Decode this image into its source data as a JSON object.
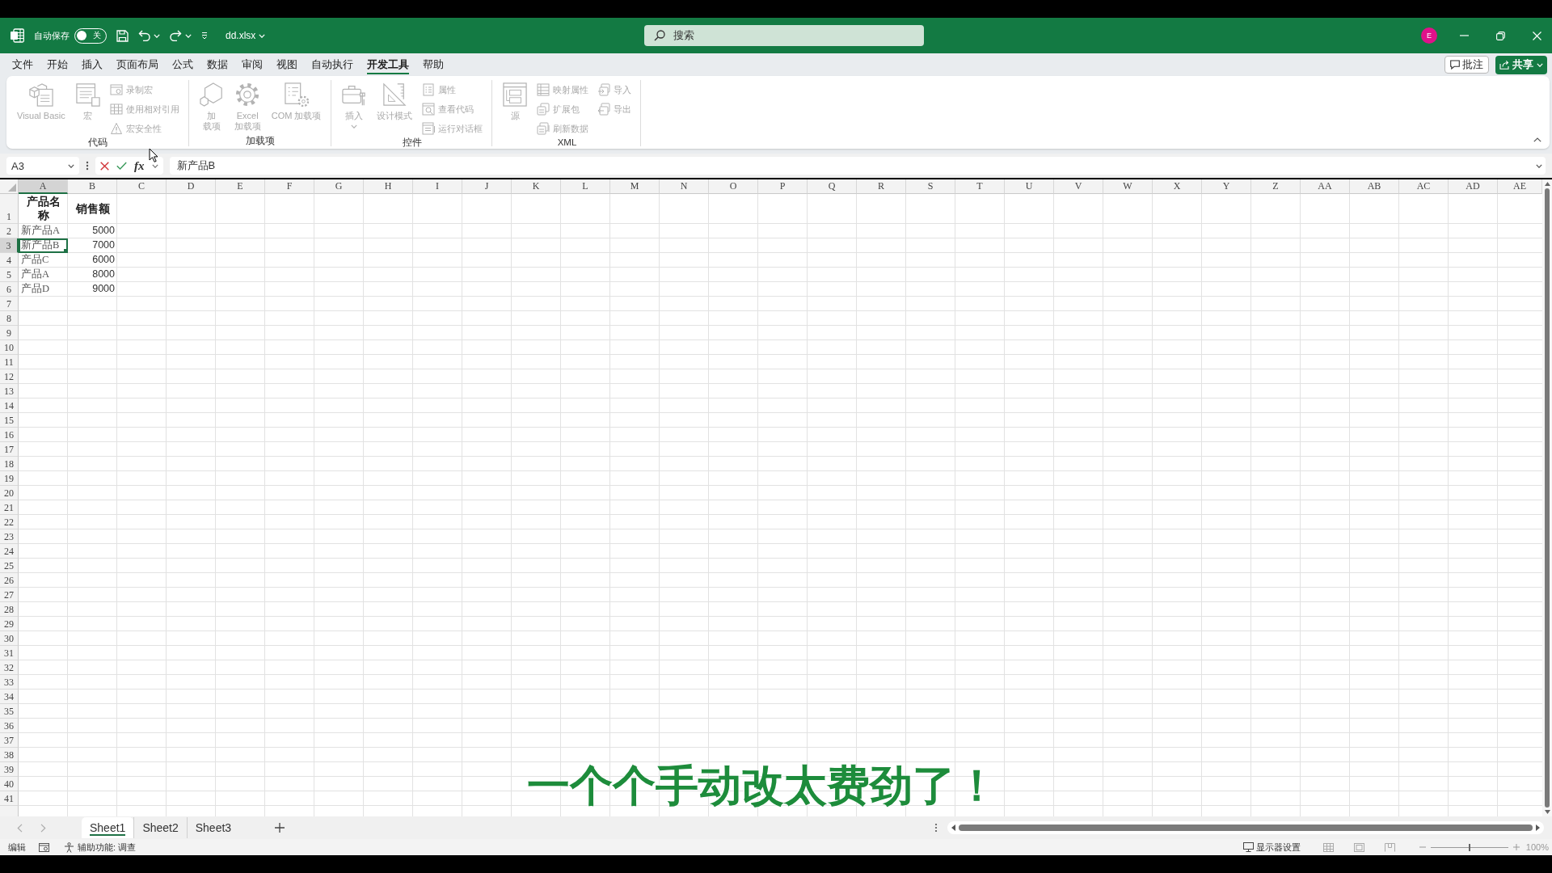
{
  "title_bar": {
    "autosave_label": "自动保存",
    "autosave_toggle": {
      "on": false,
      "label": "关"
    },
    "file_name": "dd.xlsx",
    "search": {
      "placeholder": "搜索"
    },
    "account_initial": "E"
  },
  "menu_tabs": [
    {
      "label": "文件",
      "selected": false
    },
    {
      "label": "开始",
      "selected": false
    },
    {
      "label": "插入",
      "selected": false
    },
    {
      "label": "页面布局",
      "selected": false
    },
    {
      "label": "公式",
      "selected": false
    },
    {
      "label": "数据",
      "selected": false
    },
    {
      "label": "审阅",
      "selected": false
    },
    {
      "label": "视图",
      "selected": false
    },
    {
      "label": "自动执行",
      "selected": false
    },
    {
      "label": "开发工具",
      "selected": true
    },
    {
      "label": "帮助",
      "selected": false
    }
  ],
  "comments_button": {
    "label": "批注"
  },
  "share_button": {
    "label": "共享"
  },
  "ribbon": {
    "groups": [
      {
        "label": "代码",
        "items": [
          {
            "kind": "large",
            "lines": [
              "Visual Basic"
            ],
            "disabled": true
          },
          {
            "kind": "large",
            "lines": [
              "宏"
            ],
            "disabled": true
          },
          {
            "kind": "small",
            "label": "录制宏",
            "disabled": true
          },
          {
            "kind": "small",
            "label": "使用相对引用",
            "disabled": true
          },
          {
            "kind": "small",
            "label": "宏安全性",
            "disabled": true
          }
        ]
      },
      {
        "label": "加载项",
        "items": [
          {
            "kind": "large",
            "lines": [
              "加",
              "载项"
            ],
            "disabled": true
          },
          {
            "kind": "large",
            "lines": [
              "Excel",
              "加载项"
            ],
            "disabled": true
          },
          {
            "kind": "large",
            "lines": [
              "COM 加载项"
            ],
            "disabled": true
          }
        ]
      },
      {
        "label": "控件",
        "items": [
          {
            "kind": "large",
            "lines": [
              "插入"
            ],
            "dropdown": true,
            "disabled": true
          },
          {
            "kind": "large",
            "lines": [
              "设计模式"
            ],
            "disabled": true
          },
          {
            "kind": "small",
            "label": "属性",
            "disabled": true
          },
          {
            "kind": "small",
            "label": "查看代码",
            "disabled": true
          },
          {
            "kind": "small",
            "label": "运行对话框",
            "disabled": true
          }
        ]
      },
      {
        "label": "XML",
        "items": [
          {
            "kind": "large",
            "lines": [
              "源"
            ],
            "disabled": true
          },
          {
            "kind": "small",
            "label": "映射属性",
            "disabled": true
          },
          {
            "kind": "small",
            "label": "扩展包",
            "disabled": true
          },
          {
            "kind": "small",
            "label": "刷新数据",
            "disabled": true
          },
          {
            "kind": "small",
            "label": "导入",
            "disabled": true
          },
          {
            "kind": "small",
            "label": "导出",
            "disabled": true
          }
        ]
      }
    ]
  },
  "formula_bar": {
    "name_box": "A3",
    "function_label": "fx",
    "formula": "新产品B"
  },
  "grid": {
    "columns": [
      {
        "label": "A",
        "selected": true
      },
      {
        "label": "B",
        "selected": false
      },
      {
        "label": "C",
        "selected": false
      },
      {
        "label": "D",
        "selected": false
      },
      {
        "label": "E",
        "selected": false
      },
      {
        "label": "F",
        "selected": false
      },
      {
        "label": "G",
        "selected": false
      },
      {
        "label": "H",
        "selected": false
      },
      {
        "label": "I",
        "selected": false
      },
      {
        "label": "J",
        "selected": false
      },
      {
        "label": "K",
        "selected": false
      },
      {
        "label": "L",
        "selected": false
      },
      {
        "label": "M",
        "selected": false
      },
      {
        "label": "N",
        "selected": false
      },
      {
        "label": "O",
        "selected": false
      },
      {
        "label": "P",
        "selected": false
      },
      {
        "label": "Q",
        "selected": false
      },
      {
        "label": "R",
        "selected": false
      },
      {
        "label": "S",
        "selected": false
      },
      {
        "label": "T",
        "selected": false
      },
      {
        "label": "U",
        "selected": false
      },
      {
        "label": "V",
        "selected": false
      },
      {
        "label": "W",
        "selected": false
      },
      {
        "label": "X",
        "selected": false
      },
      {
        "label": "Y",
        "selected": false
      },
      {
        "label": "Z",
        "selected": false
      },
      {
        "label": "AA",
        "selected": false
      },
      {
        "label": "AB",
        "selected": false
      },
      {
        "label": "AC",
        "selected": false
      },
      {
        "label": "AD",
        "selected": false
      },
      {
        "label": "AE",
        "selected": false
      }
    ],
    "rows": [
      {
        "label": "1",
        "selected": false,
        "cells": [
          {
            "text": "产品名称",
            "kind": "header",
            "selected": false
          },
          {
            "text": "销售额",
            "kind": "header",
            "selected": false
          }
        ]
      },
      {
        "label": "2",
        "selected": false,
        "cells": [
          {
            "text": "新产品A",
            "kind": "text",
            "selected": false
          },
          {
            "text": "5000",
            "kind": "number",
            "selected": false
          }
        ]
      },
      {
        "label": "3",
        "selected": true,
        "cells": [
          {
            "text": "新产品B",
            "kind": "text",
            "selected": true
          },
          {
            "text": "7000",
            "kind": "number",
            "selected": false
          }
        ]
      },
      {
        "label": "4",
        "selected": false,
        "cells": [
          {
            "text": "产品C",
            "kind": "text",
            "selected": false
          },
          {
            "text": "6000",
            "kind": "number",
            "selected": false
          }
        ]
      },
      {
        "label": "5",
        "selected": false,
        "cells": [
          {
            "text": "产品A",
            "kind": "text",
            "selected": false
          },
          {
            "text": "8000",
            "kind": "number",
            "selected": false
          }
        ]
      },
      {
        "label": "6",
        "selected": false,
        "cells": [
          {
            "text": "产品D",
            "kind": "text",
            "selected": false
          },
          {
            "text": "9000",
            "kind": "number",
            "selected": false
          }
        ]
      },
      {
        "label": "7",
        "selected": false
      },
      {
        "label": "8",
        "selected": false
      },
      {
        "label": "9",
        "selected": false
      },
      {
        "label": "10",
        "selected": false
      },
      {
        "label": "11",
        "selected": false
      },
      {
        "label": "12",
        "selected": false
      },
      {
        "label": "13",
        "selected": false
      },
      {
        "label": "14",
        "selected": false
      },
      {
        "label": "15",
        "selected": false
      },
      {
        "label": "16",
        "selected": false
      },
      {
        "label": "17",
        "selected": false
      },
      {
        "label": "18",
        "selected": false
      },
      {
        "label": "19",
        "selected": false
      },
      {
        "label": "20",
        "selected": false
      },
      {
        "label": "21",
        "selected": false
      },
      {
        "label": "22",
        "selected": false
      },
      {
        "label": "23",
        "selected": false
      },
      {
        "label": "24",
        "selected": false
      },
      {
        "label": "25",
        "selected": false
      },
      {
        "label": "26",
        "selected": false
      },
      {
        "label": "27",
        "selected": false
      },
      {
        "label": "28",
        "selected": false
      },
      {
        "label": "29",
        "selected": false
      },
      {
        "label": "30",
        "selected": false
      },
      {
        "label": "31",
        "selected": false
      },
      {
        "label": "32",
        "selected": false
      },
      {
        "label": "33",
        "selected": false
      },
      {
        "label": "34",
        "selected": false
      },
      {
        "label": "35",
        "selected": false
      },
      {
        "label": "36",
        "selected": false
      },
      {
        "label": "37",
        "selected": false
      },
      {
        "label": "38",
        "selected": false
      },
      {
        "label": "39",
        "selected": false
      },
      {
        "label": "40",
        "selected": false
      },
      {
        "label": "41",
        "selected": false
      }
    ]
  },
  "sheet_tabs": [
    {
      "label": "Sheet1",
      "selected": true
    },
    {
      "label": "Sheet2",
      "selected": false
    },
    {
      "label": "Sheet3",
      "selected": false
    }
  ],
  "status_bar": {
    "mode": "编辑",
    "accessibility": "辅助功能: 调查",
    "display_settings": "显示器设置",
    "zoom": {
      "level": 0.5,
      "reading": "100%"
    }
  },
  "caption": "一个个手动改太费劲了！"
}
